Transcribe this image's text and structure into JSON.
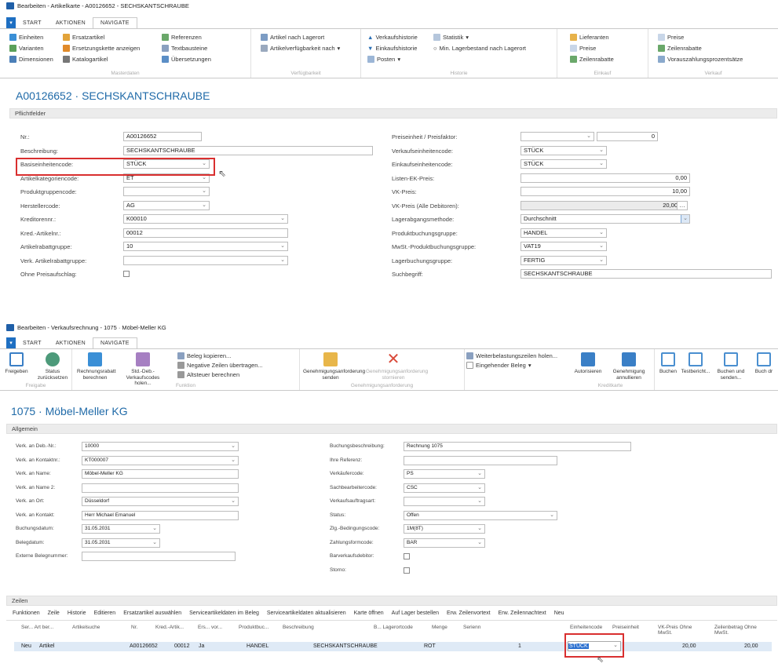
{
  "window1": {
    "title": "Bearbeiten - Artikelkarte - A00126652 - SECHSKANTSCHRAUBE",
    "tabs": [
      "START",
      "AKTIONEN",
      "NAVIGATE"
    ],
    "groups": {
      "stammdaten": "Masterdaten",
      "verfuegbarkeit": "Verfügbarkeit",
      "historie": "Historie",
      "einkauf": "Einkauf",
      "verkauf": "Verkauf"
    },
    "ribbon": {
      "einheiten": "Einheiten",
      "varianten": "Varianten",
      "dimensionen": "Dimensionen",
      "ersatzartikel": "Ersatzartikel",
      "ersatzungskette": "Ersetzungskette anzeigen",
      "katalogartikel": "Katalogartikel",
      "referenzen": "Referenzen",
      "textbausteine": "Textbausteine",
      "uebersetzungen": "Übersetzungen",
      "artikel_lagerort": "Artikel nach Lagerort",
      "artikelverfuegbarkeit": "Artikelverfügbarkeit nach",
      "verkaufshistorie": "Verkaufshistorie",
      "einkaufshistorie": "Einkaufshistorie",
      "posten": "Posten",
      "statistik": "Statistik",
      "min_lagerbestand": "Min. Lagerbestand nach Lagerort",
      "lieferanten": "Lieferanten",
      "preise": "Preise",
      "zeilenrabatte": "Zeilenrabatte",
      "v_preise": "Preise",
      "v_zeilenrabatte": "Zeilenrabatte",
      "vorauszahlung": "Vorauszahlungsprozentsätze"
    },
    "page_title": "A00126652 · SECHSKANTSCHRAUBE",
    "section": "Pflichtfelder",
    "left_fields": [
      {
        "label": "Nr.:",
        "value": "A00126652"
      },
      {
        "label": "Beschreibung:",
        "value": "SECHSKANTSCHRAUBE"
      },
      {
        "label": "Basiseinheitencode:",
        "value": "STÜCK"
      },
      {
        "label": "Artikelkategoriencode:",
        "value": "ET"
      },
      {
        "label": "Produktgruppencode:",
        "value": ""
      },
      {
        "label": "Herstellercode:",
        "value": "AG"
      },
      {
        "label": "Kreditorennr.:",
        "value": "K00010"
      },
      {
        "label": "Kred.-Artikelnr.:",
        "value": "00012"
      },
      {
        "label": "Artikelrabattgruppe:",
        "value": "10"
      },
      {
        "label": "Verk. Artikelrabattgruppe:",
        "value": ""
      },
      {
        "label": "Ohne Preisaufschlag:",
        "value": ""
      }
    ],
    "right_fields": [
      {
        "label": "Preiseinheit / Preisfaktor:",
        "value": "",
        "value2": "0"
      },
      {
        "label": "Verkaufseinheitencode:",
        "value": "STÜCK"
      },
      {
        "label": "Einkaufseinheitencode:",
        "value": "STÜCK"
      },
      {
        "label": "Listen-EK-Preis:",
        "value": "0,00"
      },
      {
        "label": "VK-Preis:",
        "value": "10,00"
      },
      {
        "label": "VK-Preis (Alle Debitoren):",
        "value": "20,00"
      },
      {
        "label": "Lagerabgangsmethode:",
        "value": "Durchschnitt"
      },
      {
        "label": "Produktbuchungsgruppe:",
        "value": "HANDEL"
      },
      {
        "label": "MwSt.-Produktbuchungsgruppe:",
        "value": "VAT19"
      },
      {
        "label": "Lagerbuchungsgruppe:",
        "value": "FERTIG"
      },
      {
        "label": "Suchbegriff:",
        "value": "SECHSKANTSCHRAUBE"
      }
    ]
  },
  "window2": {
    "title": "Bearbeiten - Verkaufsrechnung - 1075 · Möbel-Meller KG",
    "tabs": [
      "START",
      "AKTIONEN",
      "NAVIGATE"
    ],
    "buttons": {
      "freigeben": "Freigeben",
      "status": "Status zurücksetzen",
      "rechnungsrabatt": "Rechnungsrabatt berechnen",
      "std_deb": "Std.-Deb.-Verkaufscodes holen...",
      "beleg_kopieren": "Beleg kopieren...",
      "negative_zeilen": "Negative Zeilen übertragen...",
      "altsteuer": "Altsteuer berechnen",
      "genehmigung_senden": "Genehmigungsanforderung senden",
      "genehmigung_storn": "Genehmigungsanforderung stornieren",
      "weiterbelastung": "Weiterbelastungszeilen holen...",
      "eingehender_beleg": "Eingehender Beleg",
      "autorisieren": "Autorisieren",
      "genehmigung_annullieren": "Genehmigung annullieren",
      "buchen": "Buchen",
      "testbericht": "Testbericht...",
      "buchen_senden": "Buchen und senden...",
      "buchen_drucken": "Buch dr"
    },
    "groups": {
      "freigabe": "Freigabe",
      "funktion": "Funktion",
      "genehmigung": "Genehmigungsanforderung",
      "kreditkarte": "Kreditkarte"
    },
    "page_title": "1075 · Möbel-Meller KG",
    "section": "Allgemein",
    "left_fields": [
      {
        "label": "Verk. an Deb.-Nr.:",
        "value": "10000"
      },
      {
        "label": "Verk. an Kontaktnr.:",
        "value": "KT000007"
      },
      {
        "label": "Verk. an Name:",
        "value": "Möbel-Meller KG"
      },
      {
        "label": "Verk. an Name 2:",
        "value": ""
      },
      {
        "label": "Verk. an Ort:",
        "value": "Düsseldorf"
      },
      {
        "label": "Verk. an Kontakt:",
        "value": "Herr Michael Emanuel"
      },
      {
        "label": "Buchungsdatum:",
        "value": "31.05.2031"
      },
      {
        "label": "Belegdatum:",
        "value": "31.05.2031"
      },
      {
        "label": "Externe Belegnummer:",
        "value": ""
      }
    ],
    "right_fields": [
      {
        "label": "Buchungsbeschreibung:",
        "value": "Rechnung 1075"
      },
      {
        "label": "Ihre Referenz:",
        "value": ""
      },
      {
        "label": "Verkäufercode:",
        "value": "PS"
      },
      {
        "label": "Sachbearbeitercode:",
        "value": "CSC"
      },
      {
        "label": "Verkaufsauftragsart:",
        "value": ""
      },
      {
        "label": "Status:",
        "value": "Offen"
      },
      {
        "label": "Zlg.-Bedingungscode:",
        "value": "1M(8T)"
      },
      {
        "label": "Zahlungsformcode:",
        "value": "BAR"
      },
      {
        "label": "Barverkaufsdebitor:",
        "value": ""
      },
      {
        "label": "Storno:",
        "value": ""
      }
    ],
    "lines_section": "Zeilen",
    "toolbar": [
      "Funktionen",
      "Zeile",
      "Historie",
      "Editieren",
      "Ersatzartikel auswählen",
      "Serviceartikeldaten im Beleg",
      "Serviceartikeldaten aktualisieren",
      "Karte öffnen",
      "Auf Lager bestellen",
      "Erw. Zeilenvortext",
      "Erw. Zeilennachtext",
      "Neu"
    ],
    "columns": [
      "Ser... Art ber...",
      "Artikelsuche",
      "Nr.",
      "Kred.-Artik...",
      "Ers... vor...",
      "Produktbuc...",
      "Beschreibung",
      "B... Lagerortcode",
      "Menge",
      "Serienn",
      "Einheitencode",
      "Preiseinheit",
      "VK-Preis Ohne MwSt.",
      "Zeilenbetrag Ohne MwSt."
    ],
    "row": [
      "Neu",
      "Artikel",
      "A00126652",
      "00012",
      "Ja",
      "HANDEL",
      "SECHSKANTSCHRAUBE",
      "ROT",
      "1",
      "STÜCK",
      "20,00",
      "20,00"
    ]
  }
}
